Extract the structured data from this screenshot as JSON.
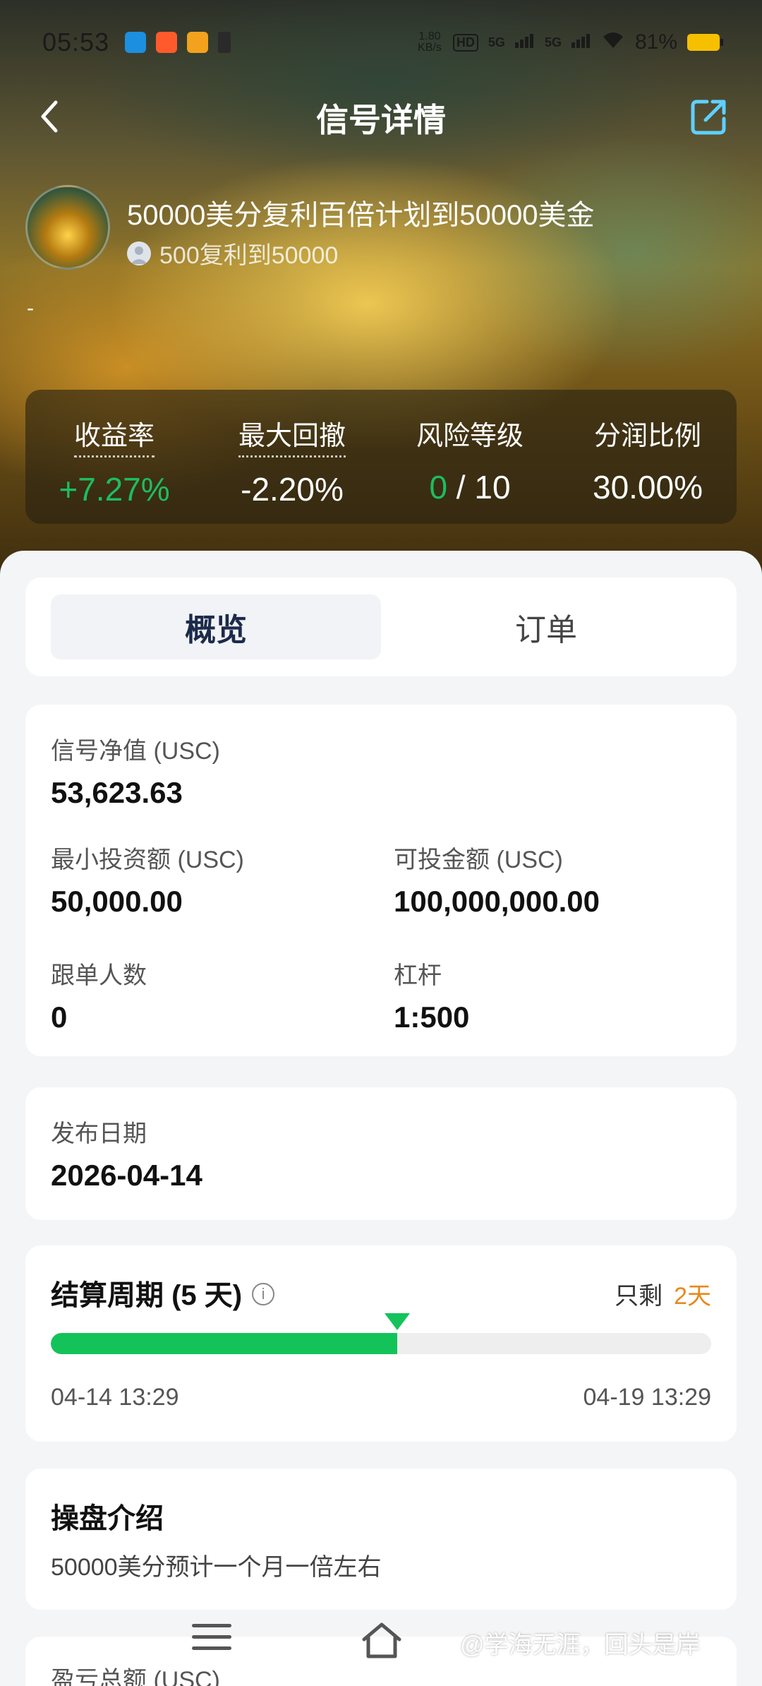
{
  "status_bar": {
    "time": "05:53",
    "network_speed": "1.80 KB/s",
    "network_badge": "HD",
    "signal_1": "5G",
    "signal_2": "5G",
    "battery_pct": "81%",
    "battery_color": "#f6c000"
  },
  "nav": {
    "back_icon": "chevron-left-icon",
    "title": "信号详情",
    "share_icon": "share-external-icon"
  },
  "signal": {
    "name": "50000美分复利百倍计划到50000美金",
    "author": "500复利到50000",
    "description": "-"
  },
  "stats": [
    {
      "label": "收益率",
      "value": "+7.27%"
    },
    {
      "label": "最大回撤",
      "value": "-2.20%"
    },
    {
      "label": "风险等级",
      "value_green": "0",
      "value_rest": " / 10"
    },
    {
      "label": "分润比例",
      "value": "30.00%"
    }
  ],
  "tabs": [
    {
      "label": "概览",
      "active": true
    },
    {
      "label": "订单",
      "active": false
    }
  ],
  "overview": {
    "net_value_label": "信号净值 (USC)",
    "net_value": "53,623.63",
    "min_invest_label": "最小投资额 (USC)",
    "min_invest": "50,000.00",
    "available_label": "可投金额 (USC)",
    "available": "100,000,000.00",
    "followers_label": "跟单人数",
    "followers": "0",
    "leverage_label": "杠杆",
    "leverage": "1:500"
  },
  "publish": {
    "label": "发布日期",
    "date": "2026-04-14"
  },
  "settlement": {
    "title": "结算周期 (5 天)",
    "info_icon": "info-icon",
    "remaining_prefix": "只剩",
    "remaining": "2天",
    "progress": 0.525,
    "start": "04-14 13:29",
    "end": "04-19 13:29",
    "accent": "#13c35a",
    "remaining_color": "#e8891d"
  },
  "intro": {
    "title": "操盘介绍",
    "text": "50000美分预计一个月一倍左右"
  },
  "pnl": {
    "label": "盈亏总额 (USC)"
  },
  "bottom_nav": {
    "menu_icon": "menu-icon",
    "home_icon": "home-icon",
    "watermark": "@学海无涯，回头是岸"
  }
}
